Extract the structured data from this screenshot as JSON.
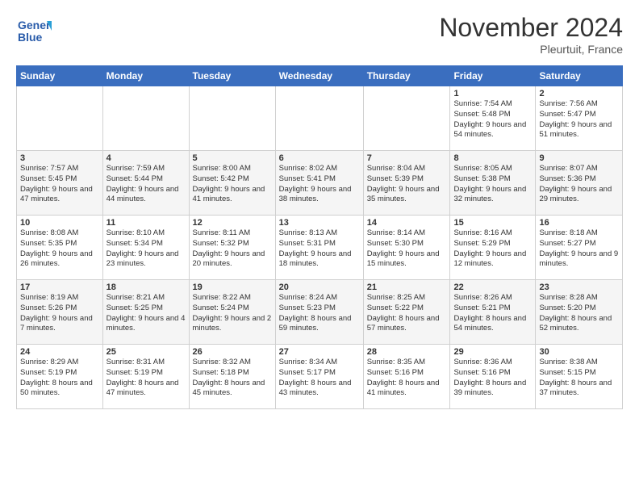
{
  "logo": {
    "line1": "General",
    "line2": "Blue"
  },
  "header": {
    "title": "November 2024",
    "subtitle": "Pleurtuit, France"
  },
  "weekdays": [
    "Sunday",
    "Monday",
    "Tuesday",
    "Wednesday",
    "Thursday",
    "Friday",
    "Saturday"
  ],
  "weeks": [
    [
      {
        "day": "",
        "info": ""
      },
      {
        "day": "",
        "info": ""
      },
      {
        "day": "",
        "info": ""
      },
      {
        "day": "",
        "info": ""
      },
      {
        "day": "",
        "info": ""
      },
      {
        "day": "1",
        "info": "Sunrise: 7:54 AM\nSunset: 5:48 PM\nDaylight: 9 hours\nand 54 minutes."
      },
      {
        "day": "2",
        "info": "Sunrise: 7:56 AM\nSunset: 5:47 PM\nDaylight: 9 hours\nand 51 minutes."
      }
    ],
    [
      {
        "day": "3",
        "info": "Sunrise: 7:57 AM\nSunset: 5:45 PM\nDaylight: 9 hours\nand 47 minutes."
      },
      {
        "day": "4",
        "info": "Sunrise: 7:59 AM\nSunset: 5:44 PM\nDaylight: 9 hours\nand 44 minutes."
      },
      {
        "day": "5",
        "info": "Sunrise: 8:00 AM\nSunset: 5:42 PM\nDaylight: 9 hours\nand 41 minutes."
      },
      {
        "day": "6",
        "info": "Sunrise: 8:02 AM\nSunset: 5:41 PM\nDaylight: 9 hours\nand 38 minutes."
      },
      {
        "day": "7",
        "info": "Sunrise: 8:04 AM\nSunset: 5:39 PM\nDaylight: 9 hours\nand 35 minutes."
      },
      {
        "day": "8",
        "info": "Sunrise: 8:05 AM\nSunset: 5:38 PM\nDaylight: 9 hours\nand 32 minutes."
      },
      {
        "day": "9",
        "info": "Sunrise: 8:07 AM\nSunset: 5:36 PM\nDaylight: 9 hours\nand 29 minutes."
      }
    ],
    [
      {
        "day": "10",
        "info": "Sunrise: 8:08 AM\nSunset: 5:35 PM\nDaylight: 9 hours\nand 26 minutes."
      },
      {
        "day": "11",
        "info": "Sunrise: 8:10 AM\nSunset: 5:34 PM\nDaylight: 9 hours\nand 23 minutes."
      },
      {
        "day": "12",
        "info": "Sunrise: 8:11 AM\nSunset: 5:32 PM\nDaylight: 9 hours\nand 20 minutes."
      },
      {
        "day": "13",
        "info": "Sunrise: 8:13 AM\nSunset: 5:31 PM\nDaylight: 9 hours\nand 18 minutes."
      },
      {
        "day": "14",
        "info": "Sunrise: 8:14 AM\nSunset: 5:30 PM\nDaylight: 9 hours\nand 15 minutes."
      },
      {
        "day": "15",
        "info": "Sunrise: 8:16 AM\nSunset: 5:29 PM\nDaylight: 9 hours\nand 12 minutes."
      },
      {
        "day": "16",
        "info": "Sunrise: 8:18 AM\nSunset: 5:27 PM\nDaylight: 9 hours\nand 9 minutes."
      }
    ],
    [
      {
        "day": "17",
        "info": "Sunrise: 8:19 AM\nSunset: 5:26 PM\nDaylight: 9 hours\nand 7 minutes."
      },
      {
        "day": "18",
        "info": "Sunrise: 8:21 AM\nSunset: 5:25 PM\nDaylight: 9 hours\nand 4 minutes."
      },
      {
        "day": "19",
        "info": "Sunrise: 8:22 AM\nSunset: 5:24 PM\nDaylight: 9 hours\nand 2 minutes."
      },
      {
        "day": "20",
        "info": "Sunrise: 8:24 AM\nSunset: 5:23 PM\nDaylight: 8 hours\nand 59 minutes."
      },
      {
        "day": "21",
        "info": "Sunrise: 8:25 AM\nSunset: 5:22 PM\nDaylight: 8 hours\nand 57 minutes."
      },
      {
        "day": "22",
        "info": "Sunrise: 8:26 AM\nSunset: 5:21 PM\nDaylight: 8 hours\nand 54 minutes."
      },
      {
        "day": "23",
        "info": "Sunrise: 8:28 AM\nSunset: 5:20 PM\nDaylight: 8 hours\nand 52 minutes."
      }
    ],
    [
      {
        "day": "24",
        "info": "Sunrise: 8:29 AM\nSunset: 5:19 PM\nDaylight: 8 hours\nand 50 minutes."
      },
      {
        "day": "25",
        "info": "Sunrise: 8:31 AM\nSunset: 5:19 PM\nDaylight: 8 hours\nand 47 minutes."
      },
      {
        "day": "26",
        "info": "Sunrise: 8:32 AM\nSunset: 5:18 PM\nDaylight: 8 hours\nand 45 minutes."
      },
      {
        "day": "27",
        "info": "Sunrise: 8:34 AM\nSunset: 5:17 PM\nDaylight: 8 hours\nand 43 minutes."
      },
      {
        "day": "28",
        "info": "Sunrise: 8:35 AM\nSunset: 5:16 PM\nDaylight: 8 hours\nand 41 minutes."
      },
      {
        "day": "29",
        "info": "Sunrise: 8:36 AM\nSunset: 5:16 PM\nDaylight: 8 hours\nand 39 minutes."
      },
      {
        "day": "30",
        "info": "Sunrise: 8:38 AM\nSunset: 5:15 PM\nDaylight: 8 hours\nand 37 minutes."
      }
    ]
  ]
}
